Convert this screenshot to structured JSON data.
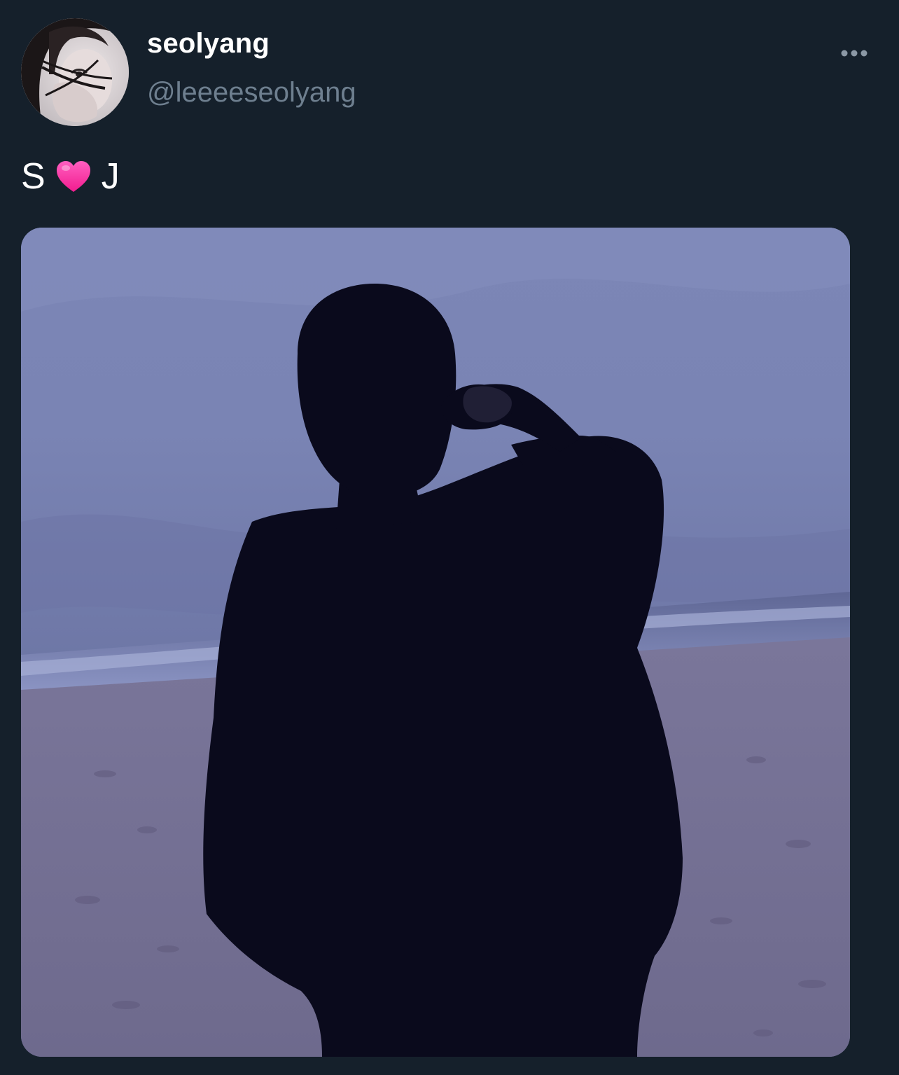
{
  "tweet": {
    "display_name": "seolyang",
    "handle": "@leeeeseolyang",
    "text_before": "S",
    "text_after": "J",
    "heart_icon": "pink-heart-emoji",
    "more_icon": "more-horizontal-icon"
  },
  "colors": {
    "background": "#15202b",
    "handle": "#6e7f8f",
    "heart": "#ff3dab"
  }
}
